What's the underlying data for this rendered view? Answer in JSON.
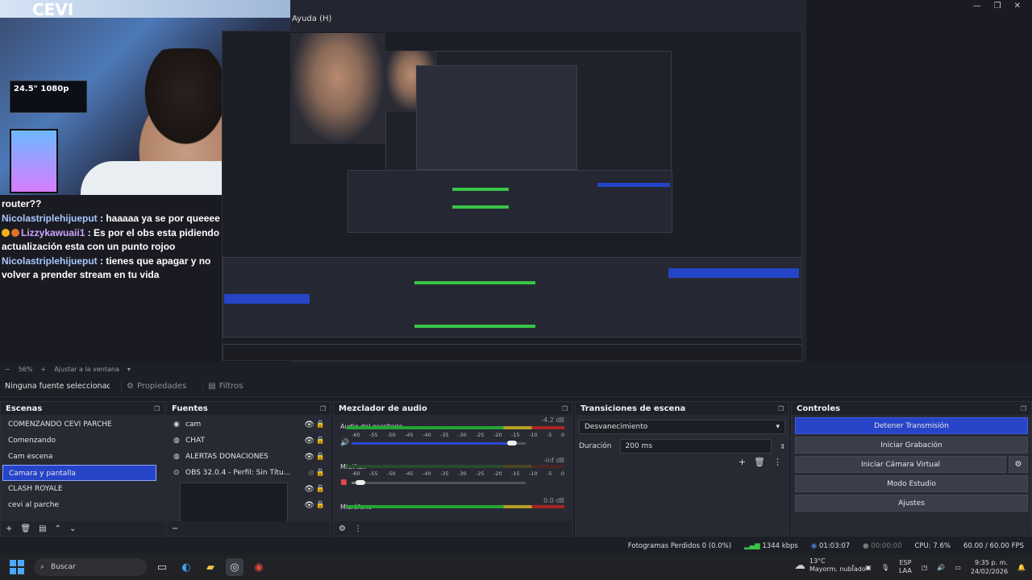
{
  "nested_window": {
    "title": "Ayuda (H)"
  },
  "camera_overlay": {
    "monitor_text": "24.5\" 1080p"
  },
  "chat": [
    {
      "user": "",
      "text": "router??"
    },
    {
      "user": "Nicolastriplehijueput",
      "text": " : haaaaa ya se por queeee"
    },
    {
      "user": "Lizzykawuaii1",
      "text": " : Es por el obs esta pidiendo actualización esta con un punto rojoo",
      "badge": true
    },
    {
      "user": "Nicolastriplehijueput",
      "text": " : tienes que apagar y no volver a prender stream en tu vida"
    }
  ],
  "zoom_bar": {
    "zoom": "56%",
    "fit": "Ajustar a la ventana"
  },
  "properties_bar": {
    "no_source": "Ninguna fuente seleccionada",
    "properties": "Propiedades",
    "filters": "Filtros"
  },
  "scenes": {
    "title": "Escenas",
    "items": [
      "COMENZANDO CEVI PARCHE",
      "Comenzando",
      "Cam escena",
      "Camara y pantalla",
      "CLASH ROYALE",
      "cevi al parche"
    ],
    "selected_index": 3
  },
  "sources": {
    "title": "Fuentes",
    "items": [
      "cam",
      "CHAT",
      "ALERTAS DONACIONES",
      "OBS 32.0.4 - Perfil: Sin Títu..."
    ]
  },
  "mixer": {
    "title": "Mezclador de audio",
    "channels": [
      {
        "name": "Audio del escritorio",
        "db": "-4.2 dB",
        "volume": 0.92,
        "muted": false
      },
      {
        "name": "Mic/Aux",
        "db": "-inf dB",
        "volume": 0.05,
        "muted": true
      },
      {
        "name": "Micrófono",
        "db": "0.0 dB",
        "volume": 1.0,
        "muted": false
      }
    ],
    "ticks": [
      "-60",
      "-55",
      "-50",
      "-45",
      "-40",
      "-35",
      "-30",
      "-25",
      "-20",
      "-15",
      "-10",
      "-5",
      "0"
    ]
  },
  "transitions": {
    "title": "Transiciones de escena",
    "selected": "Desvanecimiento",
    "duration_label": "Duración",
    "duration_value": "200 ms"
  },
  "controls": {
    "title": "Controles",
    "stop_stream": "Detener Transmisión",
    "start_recording": "Iniciar Grabación",
    "virtual_cam": "Iniciar Cámara Virtual",
    "studio_mode": "Modo Estudio",
    "settings": "Ajustes"
  },
  "status": {
    "dropped": "Fotogramas Perdidos 0 (0.0%)",
    "bitrate": "1344 kbps",
    "stream_time": "01:03:07",
    "rec_time": "00:00:00",
    "cpu": "CPU: 7.6%",
    "fps": "60.00 / 60.00 FPS"
  },
  "taskbar": {
    "search": "Buscar",
    "temp": "13°C",
    "weather": "Mayorm. nublado",
    "lang1": "ESP",
    "lang2": "LAA",
    "time": "9:35 p. m.",
    "date": "24/02/2026"
  }
}
